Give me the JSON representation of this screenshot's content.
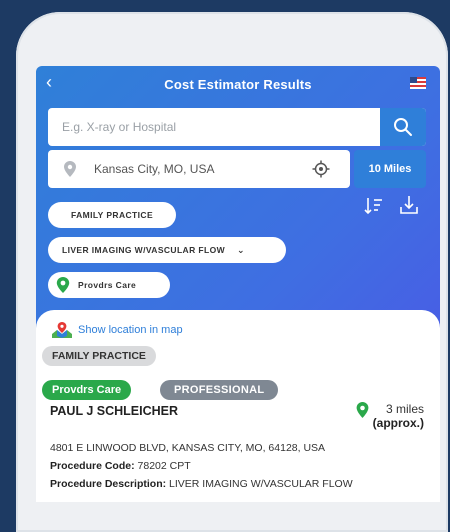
{
  "header": {
    "title": "Cost Estimator Results",
    "back_icon": "chevron-left-icon",
    "flag_icon": "flag-icon"
  },
  "search": {
    "placeholder": "E.g. X-ray or Hospital",
    "value": ""
  },
  "location": {
    "value": "Kansas City, MO, USA"
  },
  "radius": {
    "label": "10 Miles"
  },
  "filters": {
    "specialty": "FAMILY PRACTICE",
    "procedure": "LIVER IMAGING W/VASCULAR FLOW",
    "network": "Provdrs Care"
  },
  "result": {
    "map_link": "Show location in map",
    "specialty_tag": "FAMILY PRACTICE",
    "network_tag": "Provdrs Care",
    "type_tag": "PROFESSIONAL",
    "provider_name": "PAUL J SCHLEICHER",
    "distance": "3 miles",
    "distance_note": "(approx.)",
    "address": "4801 E LINWOOD BLVD, KANSAS CITY, MO, 64128, USA",
    "procedure_code_label": "Procedure Code:",
    "procedure_code": "78202 CPT",
    "procedure_desc_label": "Procedure Description:",
    "procedure_desc": "LIVER IMAGING W/VASCULAR FLOW"
  },
  "colors": {
    "primary": "#2f7fd9",
    "green": "#2aa84a",
    "grey_tag": "#7f8893"
  }
}
